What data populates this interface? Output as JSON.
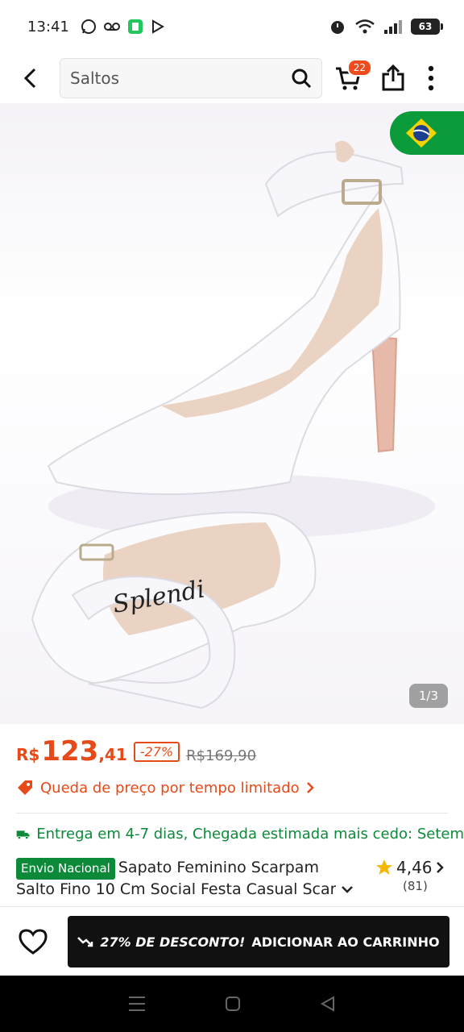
{
  "status_bar": {
    "time": "13:41",
    "battery": "63"
  },
  "header": {
    "search_text": "Saltos",
    "cart_count": "22"
  },
  "gallery": {
    "page_indicator": "1/3",
    "shoe_brand_text": "Splendi"
  },
  "price": {
    "currency": "R$",
    "integer": "123",
    "decimal": ",41",
    "discount": "-27%",
    "old_price": "R$169,90"
  },
  "price_drop": {
    "text": "Queda de preço por tempo limitado"
  },
  "delivery": {
    "text": "Entrega em 4-7 dias, Chegada estimada mais cedo: Setem"
  },
  "product": {
    "badge": "Envio Nacional",
    "title_line1": "Sapato Feminino Scarpam",
    "title_line2": "Salto Fino 10 Cm Social Festa Casual Scar"
  },
  "rating": {
    "value": "4,46",
    "count": "(81)"
  },
  "action_bar": {
    "promo": "27% DE DESCONTO!",
    "add_to_cart": "ADICIONAR AO CARRINHO"
  },
  "colors": {
    "accent": "#e64a19",
    "green": "#0c8a3a",
    "button": "#111111"
  }
}
